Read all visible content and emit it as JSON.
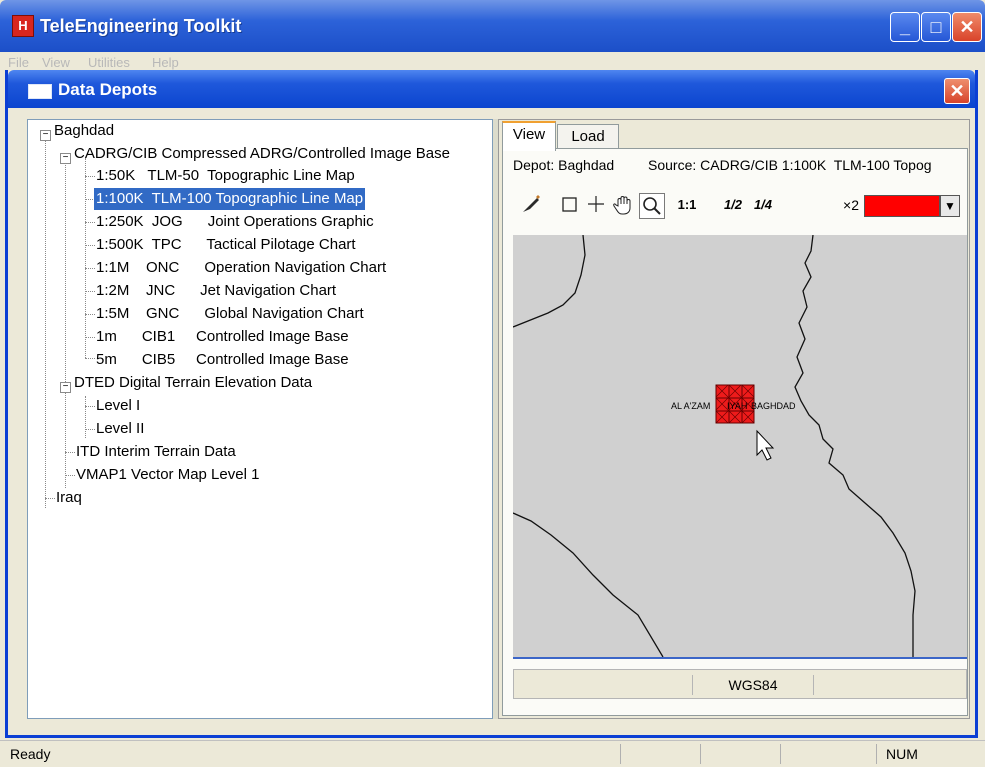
{
  "app": {
    "title": "TeleEngineering Toolkit",
    "menu": [
      "File",
      "View",
      "Utilities",
      "Help"
    ]
  },
  "dialog": {
    "title": "Data Depots",
    "tree": {
      "root1": "Baghdad",
      "cadrg": "CADRG/CIB Compressed ADRG/Controlled Image Base",
      "cadrg_items": [
        "1:50K   TLM-50  Topographic Line Map",
        "1:100K  TLM-100 Topographic Line Map",
        "1:250K  JOG      Joint Operations Graphic",
        "1:500K  TPC      Tactical Pilotage Chart",
        "1:1M    ONC      Operation Navigation Chart",
        "1:2M    JNC      Jet Navigation Chart",
        "1:5M    GNC      Global Navigation Chart",
        "1m      CIB1     Controlled Image Base",
        "5m      CIB5     Controlled Image Base"
      ],
      "selected_index": 1,
      "dted": "DTED Digital Terrain Elevation Data",
      "dted_items": [
        "Level I",
        "Level II"
      ],
      "itd": "ITD Interim Terrain Data",
      "vmap": "VMAP1 Vector Map Level 1",
      "root2": "Iraq"
    },
    "tabs": [
      "View",
      "Load"
    ],
    "active_tab": "View",
    "depot_label": "Depot: Baghdad",
    "source_label": "Source: CADRG/CIB 1:100K  TLM-100 Topog",
    "toolbar": {
      "scale_1_1": "1:1",
      "scale_1_2": "1/2",
      "scale_1_4": "1/4",
      "zoom_x2": "×2",
      "color": "#ff0000"
    },
    "map": {
      "label_left": "AL A'ZAM",
      "label_mid": "IYAH",
      "label_right": "BAGHDAD"
    },
    "projection": "WGS84"
  },
  "statusbar": {
    "text": "Ready",
    "num": "NUM"
  }
}
